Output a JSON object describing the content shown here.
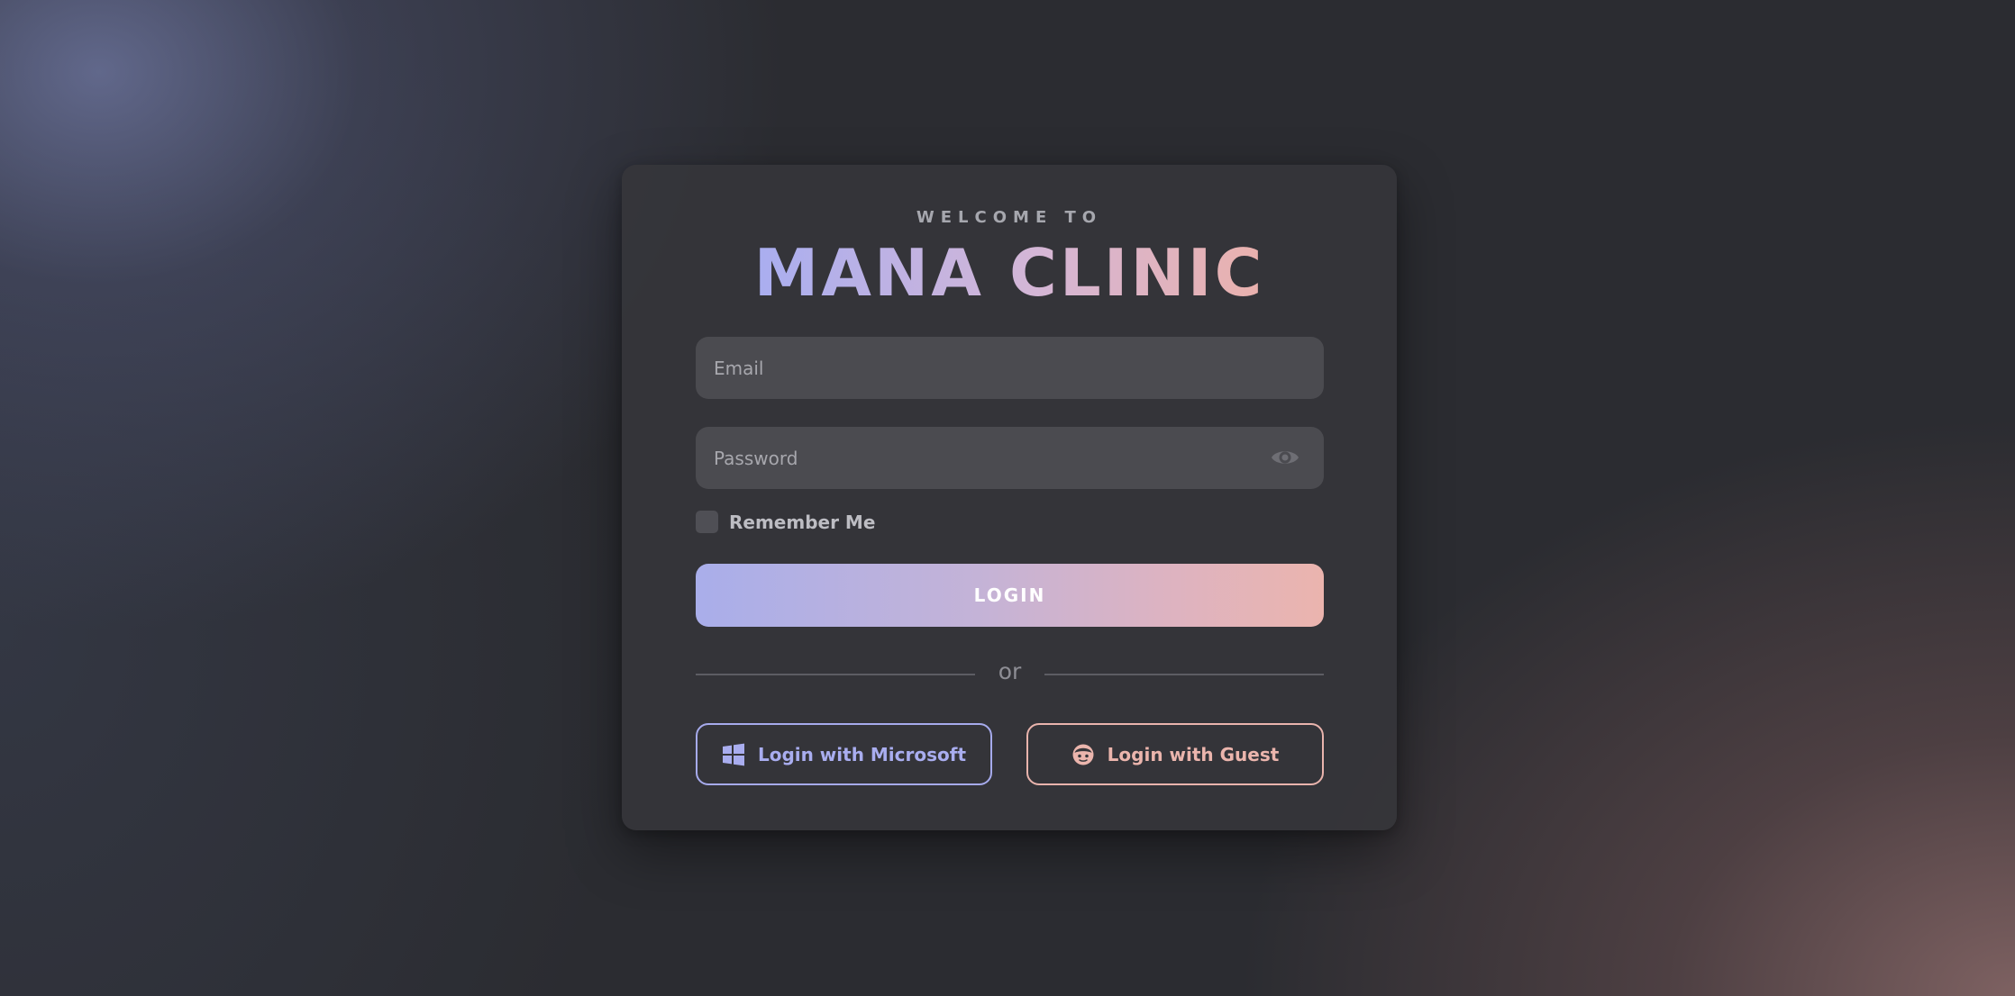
{
  "header": {
    "welcome": "WELCOME TO",
    "brand": "MANA CLINIC"
  },
  "form": {
    "email_placeholder": "Email",
    "password_placeholder": "Password",
    "remember_label": "Remember Me",
    "remember_checked": false,
    "login_label": "LOGIN",
    "divider_text": "or",
    "microsoft_label": "Login with Microsoft",
    "guest_label": "Login with Guest"
  },
  "icons": {
    "password_toggle": "eye-icon",
    "microsoft": "windows-logo-icon",
    "guest": "face-icon"
  },
  "colors": {
    "accent_start": "#a9aeea",
    "accent_end": "#ebb4ae",
    "microsoft": "#a9adef",
    "guest": "#ebb5ad"
  }
}
